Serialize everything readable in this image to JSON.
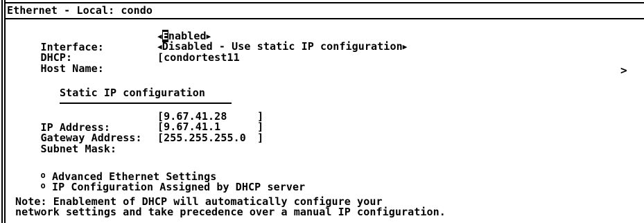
{
  "window": {
    "title": "Ethernet - Local: condo"
  },
  "fields": {
    "interface_label": "Interface:",
    "interface_value": "Enabled",
    "interface_value_rest": "nabled",
    "interface_value_first": "E",
    "dhcp_label": "DHCP:",
    "dhcp_value": "Disabled - Use static IP configuration",
    "hostname_label": "Host Name:",
    "hostname_value": "condortest11",
    "more_indicator": ">"
  },
  "static_ip": {
    "heading": "Static IP configuration",
    "ip_label": "IP Address:",
    "ip_value": "9.67.41.28",
    "gateway_label": "Gateway Address:",
    "gateway_value": "9.67.41.1",
    "subnet_label": "Subnet Mask:",
    "subnet_value": "255.255.255.0"
  },
  "links": {
    "advanced": "Advanced Ethernet Settings",
    "dhcp_assigned": "IP Configuration Assigned by DHCP server"
  },
  "note": {
    "line1": "Note: Enablement of DHCP will automatically configure your",
    "line2": "network settings and take precedence over a manual IP configuration."
  }
}
